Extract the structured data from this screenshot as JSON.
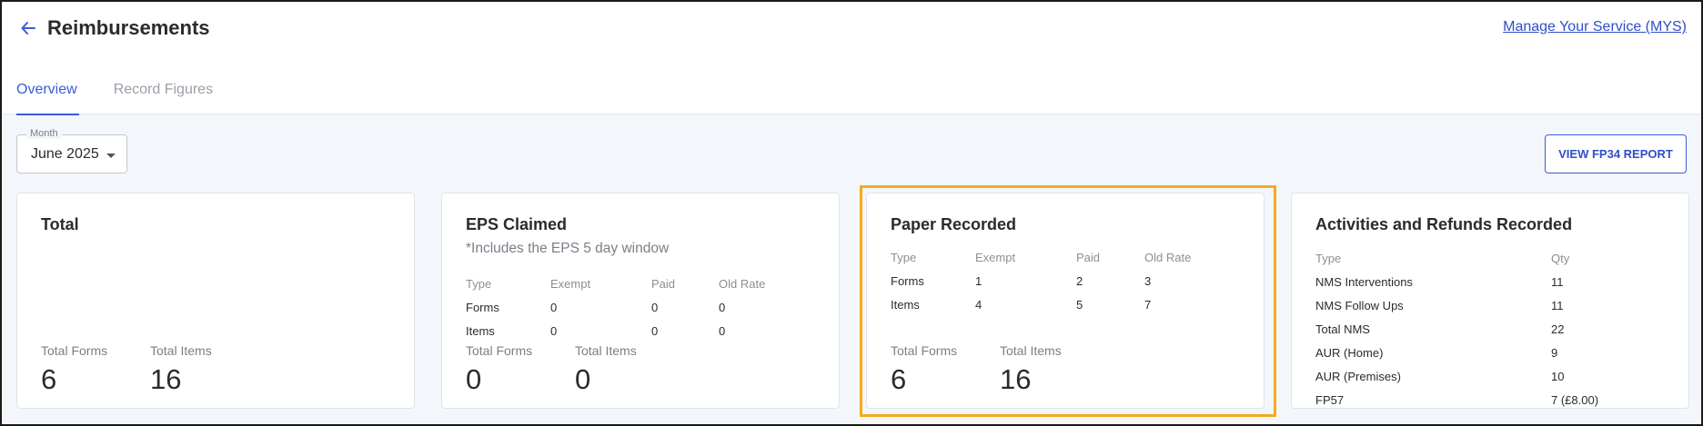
{
  "header": {
    "title": "Reimbursements",
    "mys_link": "Manage Your Service (MYS)"
  },
  "tabs": [
    {
      "label": "Overview",
      "active": true
    },
    {
      "label": "Record Figures",
      "active": false
    }
  ],
  "month_select": {
    "legend": "Month",
    "value": "June 2025"
  },
  "report_button": {
    "label": "VIEW FP34 REPORT"
  },
  "cards": {
    "total": {
      "title": "Total",
      "total_forms_label": "Total Forms",
      "total_forms": "6",
      "total_items_label": "Total Items",
      "total_items": "16"
    },
    "eps": {
      "title": "EPS Claimed",
      "subtitle": "*Includes the EPS 5 day window",
      "headers": [
        "Type",
        "Exempt",
        "Paid",
        "Old Rate"
      ],
      "rows": [
        [
          "Forms",
          "0",
          "0",
          "0"
        ],
        [
          "Items",
          "0",
          "0",
          "0"
        ]
      ],
      "total_forms_label": "Total Forms",
      "total_forms": "0",
      "total_items_label": "Total Items",
      "total_items": "0"
    },
    "paper": {
      "title": "Paper Recorded",
      "headers": [
        "Type",
        "Exempt",
        "Paid",
        "Old Rate"
      ],
      "rows": [
        [
          "Forms",
          "1",
          "2",
          "3"
        ],
        [
          "Items",
          "4",
          "5",
          "7"
        ]
      ],
      "total_forms_label": "Total Forms",
      "total_forms": "6",
      "total_items_label": "Total Items",
      "total_items": "16"
    },
    "activities": {
      "title": "Activities and Refunds Recorded",
      "headers": [
        "Type",
        "Qty"
      ],
      "rows": [
        [
          "NMS Interventions",
          "11"
        ],
        [
          "NMS Follow Ups",
          "11"
        ],
        [
          "Total NMS",
          "22"
        ],
        [
          "AUR (Home)",
          "9"
        ],
        [
          "AUR (Premises)",
          "10"
        ],
        [
          "FP57",
          "7 (£8.00)"
        ]
      ]
    }
  },
  "colors": {
    "accent": "#3b5bdb",
    "highlight": "#f2ab1c",
    "background": "#f3f6fb"
  }
}
